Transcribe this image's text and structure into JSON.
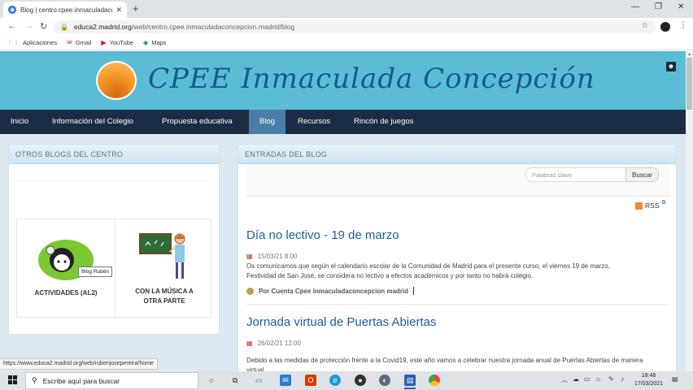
{
  "browser": {
    "tab_title": "Blog | centro.cpee.inmaculadaconcepcion...",
    "tab_close": "✕",
    "new_tab": "+",
    "url_host": "educa2.madrid.org",
    "url_path": "/web/centro.cpee.inmaculadaconcepcion.madrid/blog",
    "bookmarks": [
      {
        "label": "Aplicaciones",
        "icon": "apps-grid-icon"
      },
      {
        "label": "Gmail",
        "icon": "gmail-icon"
      },
      {
        "label": "YouTube",
        "icon": "youtube-icon"
      },
      {
        "label": "Maps",
        "icon": "maps-icon"
      }
    ]
  },
  "site": {
    "title": "CPEE Inmaculada Concepción",
    "nav": [
      "Inicio",
      "Información del Colegio",
      "Propuesta educativa",
      "Blog",
      "Recursos",
      "Rincón de juegos"
    ],
    "active_nav": "Blog"
  },
  "sidebar": {
    "heading": "OTROS BLOGS DEL CENTRO",
    "blogs": [
      {
        "label": "ACTIVIDADES (AL2)"
      },
      {
        "label": "CON LA MÚSICA A OTRA PARTE"
      }
    ],
    "tooltip": "Blog Rubén"
  },
  "main": {
    "heading": "ENTRADAS DEL BLOG",
    "search_placeholder": "Palabras clave",
    "search_button": "Buscar",
    "rss": "RSS",
    "entries": [
      {
        "title": "Día no lectivo - 19 de marzo",
        "date": "15/03/21 8:00",
        "text": "Os comunicamos que según el calendario escolar de la Comunidad de Madrid para el presente curso, el viernes 19 de marzo, Festividad de San José, se considera no lectivo a efectos académicos y por tanto no habrá colegio.",
        "author": "Por Cuenta Cpee inmaculadaconcepcion madrid"
      },
      {
        "title": "Jornada virtual de Puertas Abiertas",
        "date": "26/02/21 12:00",
        "text": "Debido a las medidas de protección frente a la Covid19, este año vamos a celebrar nuestra jornada anual de Puertas Abiertas de manera virtual."
      }
    ]
  },
  "status_url": "https://www.educa2.madrid.org/web/rubenjosepereira/home",
  "taskbar": {
    "search_text": "Escribe aquí para buscar",
    "time": "18:48",
    "date": "17/03/2021"
  }
}
